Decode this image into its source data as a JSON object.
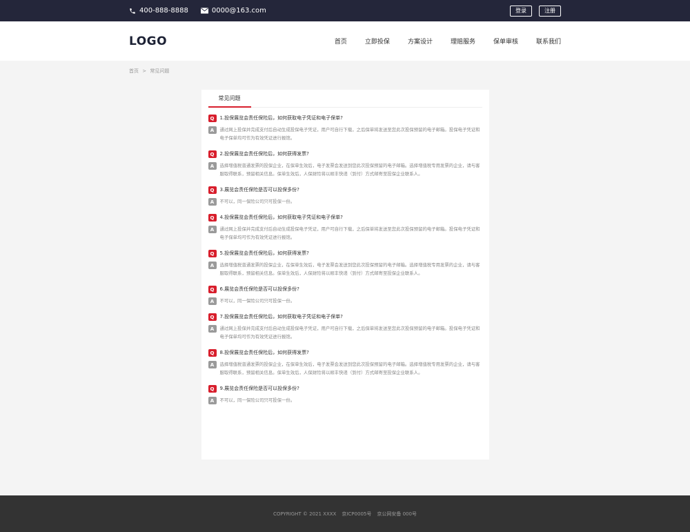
{
  "topbar": {
    "phone": "400-888-8888",
    "email": "0000@163.com",
    "login_label": "登录",
    "register_label": "注册"
  },
  "header": {
    "logo": "LOGO",
    "nav": [
      "首页",
      "立即投保",
      "方案设计",
      "理赔服务",
      "保单审核",
      "联系我们"
    ]
  },
  "breadcrumb": {
    "home": "首页",
    "separator": ">",
    "current": "常见问题"
  },
  "panel": {
    "tab_label": "常见问题",
    "q_badge": "Q",
    "a_badge": "A",
    "items": [
      {
        "q": "1.投保展览会责任保险后，如何获取电子凭证和电子保单?",
        "a": "通过网上投保并完成支付后自动生成投保电子凭证，用户可自行下载，之后保单将发送至您此次投保预留的电子邮箱。投保电子凭证和电子保单均可作为有效凭证进行报馆。"
      },
      {
        "q": "2.投保展览会责任保险后，如何获得发票?",
        "a": "选择增值税普通发票的投保企业，在保单生效后，电子发票会发送到您此次投保预留的电子邮箱。选择增值税专用发票的企业，请与客服取得联系，预留相关信息。保单生效后，人保财险将以顺丰快递（到付）方式邮寄至投保企业联系人。"
      },
      {
        "q": "3.展览会责任保险是否可以投保多份?",
        "a": "不可以，同一保险公司只可投保一份。"
      },
      {
        "q": "4.投保展览会责任保险后，如何获取电子凭证和电子保单?",
        "a": "通过网上投保并完成支付后自动生成投保电子凭证，用户可自行下载，之后保单将发送至您此次投保预留的电子邮箱。投保电子凭证和电子保单均可作为有效凭证进行报馆。"
      },
      {
        "q": "5.投保展览会责任保险后，如何获得发票?",
        "a": "选择增值税普通发票的投保企业，在保单生效后，电子发票会发送到您此次投保预留的电子邮箱。选择增值税专用发票的企业，请与客服取得联系，预留相关信息。保单生效后，人保财险将以顺丰快递（到付）方式邮寄至投保企业联系人。"
      },
      {
        "q": "6.展览会责任保险是否可以投保多份?",
        "a": "不可以，同一保险公司只可投保一份。"
      },
      {
        "q": "7.投保展览会责任保险后，如何获取电子凭证和电子保单?",
        "a": "通过网上投保并完成支付后自动生成投保电子凭证，用户可自行下载，之后保单将发送至您此次投保预留的电子邮箱。投保电子凭证和电子保单均可作为有效凭证进行报馆。"
      },
      {
        "q": "8.投保展览会责任保险后，如何获得发票?",
        "a": "选择增值税普通发票的投保企业，在保单生效后，电子发票会发送到您此次投保预留的电子邮箱。选择增值税专用发票的企业，请与客服取得联系，预留相关信息。保单生效后，人保财险将以顺丰快递（到付）方式邮寄至投保企业联系人。"
      },
      {
        "q": "9.展览会责任保险是否可以投保多份?",
        "a": "不可以，同一保险公司只可投保一份。"
      }
    ]
  },
  "footer": {
    "copyright": "COPYRIGHT © 2021 XXXX",
    "icp": "京ICP0005号",
    "police": "京公网安备 000号"
  },
  "colors": {
    "topbar_bg": "#24263a",
    "accent_red": "#d81e2c",
    "footer_bg": "#333333"
  }
}
